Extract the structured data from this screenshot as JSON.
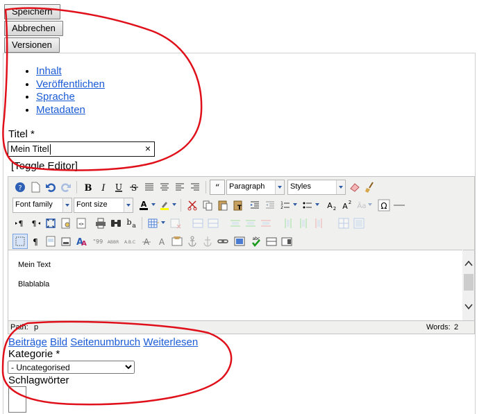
{
  "buttons": {
    "save": "Speichern",
    "cancel": "Abbrechen",
    "versions": "Versionen"
  },
  "nav": [
    "Inhalt",
    "Veröffentlichen",
    "Sprache",
    "Metadaten"
  ],
  "title_field": {
    "label": "Titel *",
    "value": "Mein Titel",
    "clear": "×"
  },
  "toggle_editor": "[Toggle Editor]",
  "toolbar": {
    "format_value": "Paragraph",
    "styles_value": "Styles",
    "font_family": "Font family",
    "font_size": "Font size"
  },
  "editor": {
    "paragraphs": [
      "Mein Text",
      "Blablabla"
    ],
    "path_label": "Path:",
    "path_value": "p",
    "words_label": "Words:",
    "words_value": "2"
  },
  "extra_buttons": [
    "Beiträge",
    "Bild",
    "Seitenumbruch",
    "Weiterlesen"
  ],
  "category": {
    "label": "Kategorie *",
    "selected": "- Uncategorised"
  },
  "tags_label": "Schlagwörter",
  "colors": {
    "accent": "#1a5bd6",
    "annotation": "#e0101a"
  }
}
